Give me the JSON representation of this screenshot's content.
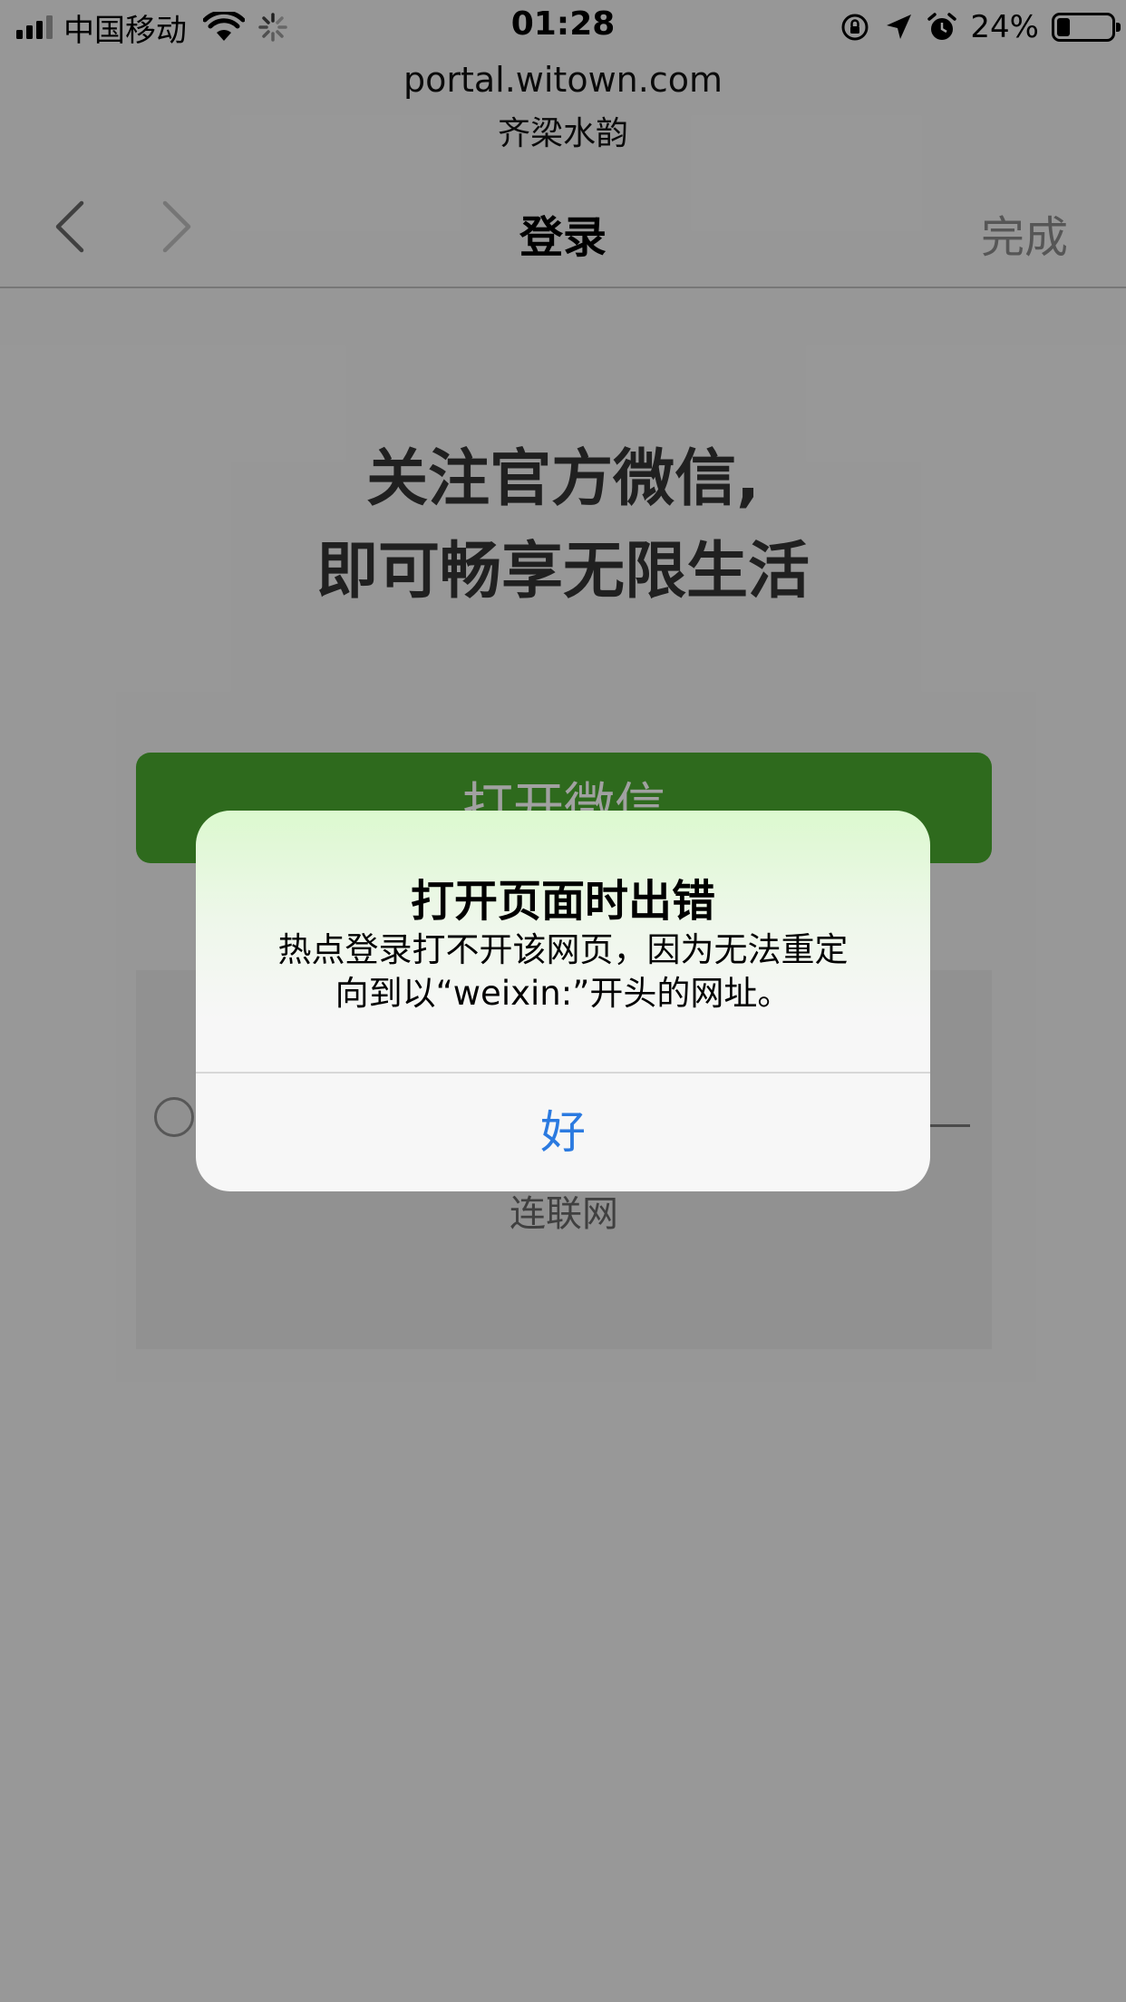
{
  "status_bar": {
    "carrier": "中国移动",
    "time": "01:28",
    "battery_percent": "24%",
    "battery_level": 0.24,
    "icons": [
      "signal-icon",
      "wifi-icon",
      "activity-spinner-icon",
      "orientation-lock-icon",
      "location-arrow-icon",
      "alarm-icon",
      "battery-icon"
    ]
  },
  "browser": {
    "domain": "portal.witown.com",
    "site_name": "齐梁水韵"
  },
  "nav": {
    "title": "登录",
    "done_label": "完成",
    "back_icon": "chevron-left-icon",
    "forward_icon": "chevron-right-icon"
  },
  "page": {
    "headline_line1": "关注官方微信,",
    "headline_line2": "即可畅享无限生活",
    "open_wechat_label": "打开微信",
    "panel_text": "连联网",
    "button_color": "#4aa82f"
  },
  "alert": {
    "title": "打开页面时出错",
    "message_line1": "热点登录打不开该网页，因为无法重定",
    "message_line2": "向到以“weixin:”开头的网址。",
    "ok_label": "好",
    "ok_color": "#2b7ae0"
  }
}
